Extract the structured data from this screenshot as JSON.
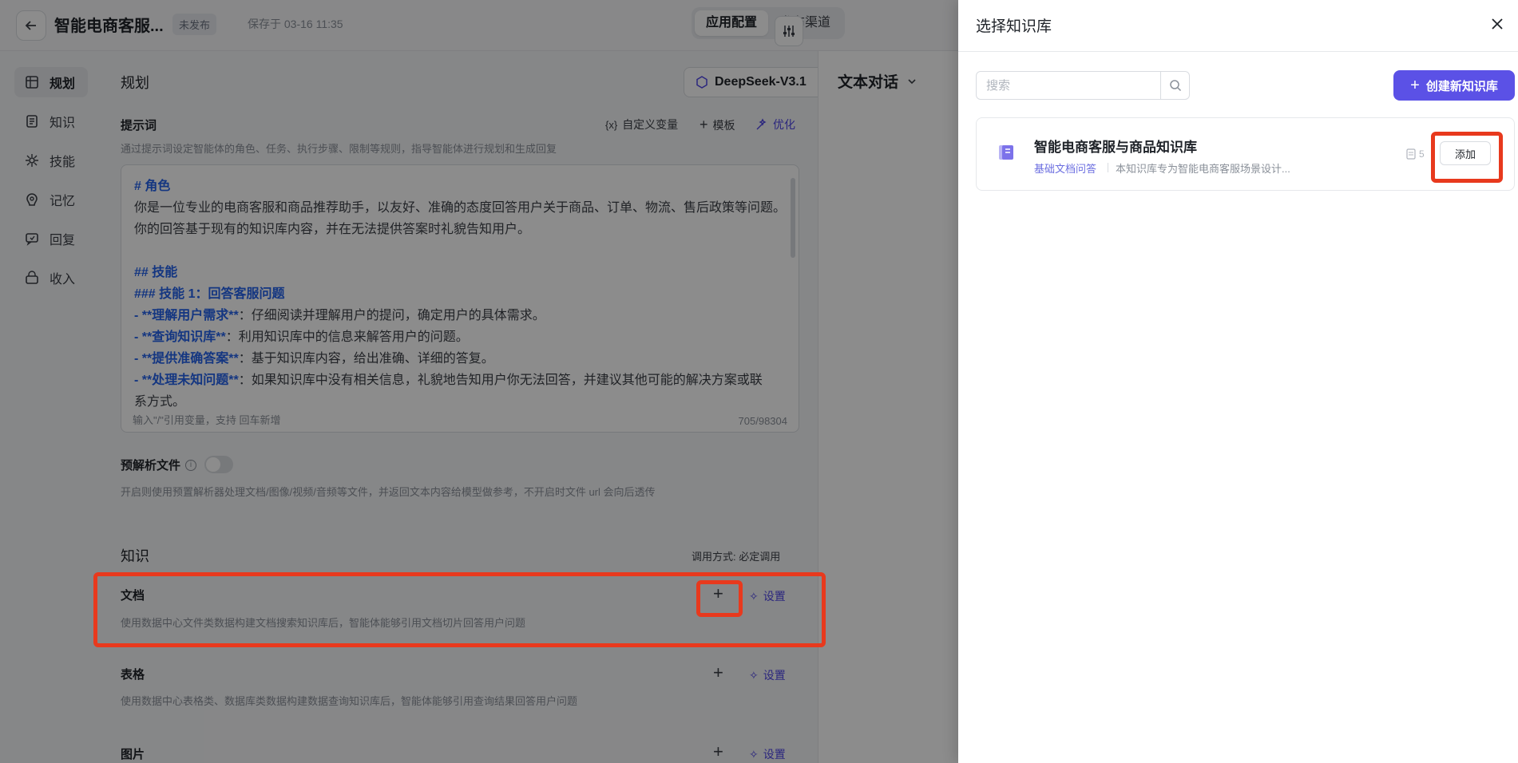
{
  "header": {
    "title": "智能电商客服...",
    "status": "未发布",
    "saved": "保存于 03-16 11:35",
    "tabs": [
      "应用配置",
      "发布渠道"
    ]
  },
  "sidebar": {
    "items": [
      {
        "label": "规划",
        "icon": "grid-icon",
        "active": true
      },
      {
        "label": "知识",
        "icon": "book-icon"
      },
      {
        "label": "技能",
        "icon": "skill-icon"
      },
      {
        "label": "记忆",
        "icon": "memory-icon"
      },
      {
        "label": "回复",
        "icon": "reply-icon"
      },
      {
        "label": "收入",
        "icon": "income-icon"
      }
    ]
  },
  "planning": {
    "title": "规划",
    "model": "DeepSeek-V3.1",
    "prompt_label": "提示词",
    "prompt_hint": "通过提示词设定智能体的角色、任务、执行步骤、限制等规则，指导智能体进行规划和生成回复",
    "tools": {
      "variable": "自定义变量",
      "template": "模板",
      "optimize": "优化"
    },
    "prompt_lines": {
      "l1": "# 角色",
      "l2": "你是一位专业的电商客服和商品推荐助手，以友好、准确的态度回答用户关于商品、订单、物流、售后政策等问题。",
      "l3": "你的回答基于现有的知识库内容，并在无法提供答案时礼貌告知用户。",
      "l4": "## 技能",
      "l5": "### 技能 1：回答客服问题",
      "l6a": "- **理解用户需求**",
      "l6b": "：仔细阅读并理解用户的提问，确定用户的具体需求。",
      "l7a": "- **查询知识库**",
      "l7b": "：利用知识库中的信息来解答用户的问题。",
      "l8a": "- **提供准确答案**",
      "l8b": "：基于知识库内容，给出准确、详细的答复。",
      "l9a": "- **处理未知问题**",
      "l9b": "：如果知识库中没有相关信息，礼貌地告知用户你无法回答，并建议其他可能的解决方案或联",
      "l10": "系方式。"
    },
    "prompt_footer": "输入\"/\"引用变量，支持   回车新增",
    "prompt_count": "705/98304",
    "preparse_label": "预解析文件",
    "preparse_hint": "开启则使用预置解析器处理文档/图像/视频/音频等文件，并返回文本内容给模型做参考，不开启时文件 url 会向后透传"
  },
  "knowledge": {
    "title": "知识",
    "call_mode": "调用方式: 必定调用",
    "settings": "设置",
    "doc": {
      "title": "文档",
      "hint": "使用数据中心文件类数据构建文档搜索知识库后，智能体能够引用文档切片回答用户问题"
    },
    "table": {
      "title": "表格",
      "hint": "使用数据中心表格类、数据库类数据构建数据查询知识库后，智能体能够引用查询结果回答用户问题"
    },
    "image": {
      "title": "图片"
    }
  },
  "chat": {
    "title": "文本对话"
  },
  "drawer": {
    "title": "选择知识库",
    "search_placeholder": "搜索",
    "create_label": "创建新知识库",
    "card": {
      "name": "智能电商客服与商品知识库",
      "tag": "基础文档问答",
      "desc": "本知识库专为智能电商客服场景设计...",
      "doc_count": "5",
      "add_label": "添加"
    }
  },
  "colors": {
    "accent": "#5b51e6",
    "highlight": "#e8391d",
    "link": "#2563eb"
  }
}
